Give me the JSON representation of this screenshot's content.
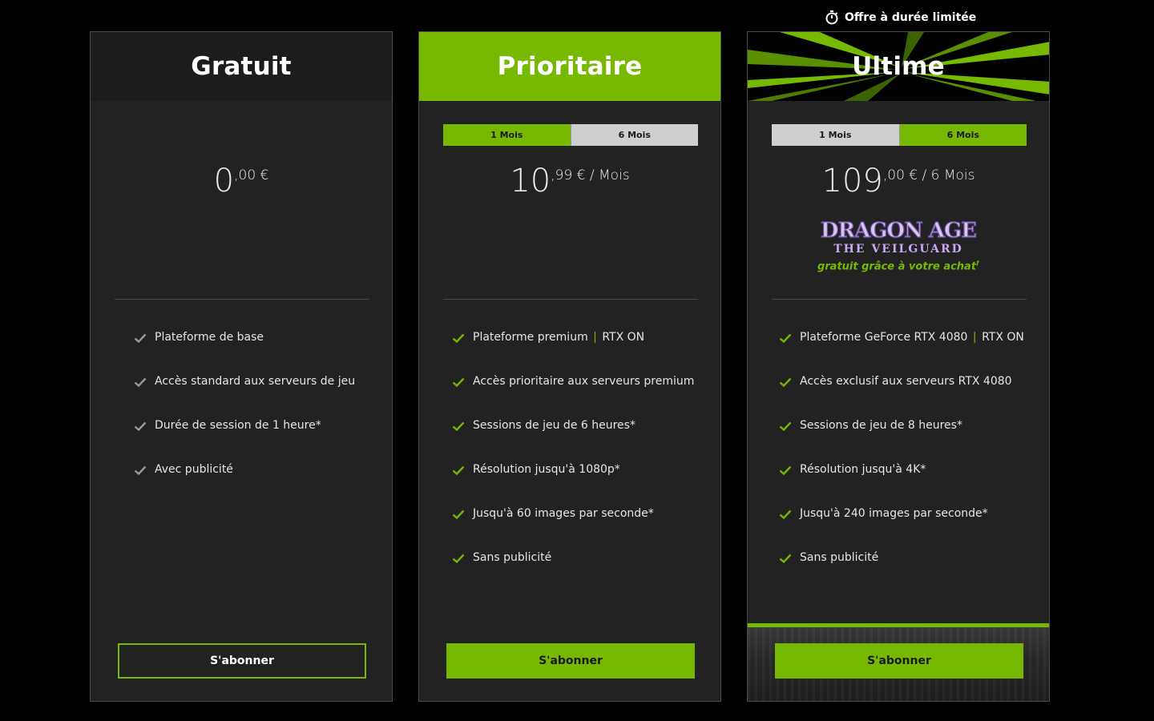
{
  "limited_offer": {
    "label": "Offre à durée limitée",
    "icon": "stopwatch-icon"
  },
  "accent_color": "#76b900",
  "plans": [
    {
      "title": "Gratuit",
      "price_int": "0",
      "price_suffix": ",00 €",
      "features": [
        {
          "text": "Plateforme de base"
        },
        {
          "text": "Accès standard aux serveurs de jeu"
        },
        {
          "text": "Durée de session de 1 heure*"
        },
        {
          "text": "Avec publicité"
        }
      ],
      "button": "S'abonner"
    },
    {
      "title": "Prioritaire",
      "toggle": {
        "options": [
          "1 Mois",
          "6 Mois"
        ],
        "selected": "1 Mois"
      },
      "price_int": "10",
      "price_suffix": ",99 € / Mois",
      "features": [
        {
          "text": "Plateforme premium",
          "extra": "RTX ON"
        },
        {
          "text": "Accès prioritaire aux serveurs premium"
        },
        {
          "text": "Sessions de jeu de 6 heures*"
        },
        {
          "text": "Résolution jusqu'à 1080p*"
        },
        {
          "text": "Jusqu'à 60 images par seconde*"
        },
        {
          "text": "Sans publicité"
        }
      ],
      "button": "S'abonner"
    },
    {
      "title": "Ultime",
      "toggle": {
        "options": [
          "1 Mois",
          "6 Mois"
        ],
        "selected": "6 Mois"
      },
      "price_int": "109",
      "price_suffix": ",00 € / 6 Mois",
      "promo": {
        "logo_line1": "DRAGON AGE",
        "logo_line2": "THE VEILGUARD",
        "text": "gratuit grâce à votre achat",
        "dagger": "†"
      },
      "features": [
        {
          "text": "Plateforme GeForce RTX 4080",
          "extra": "RTX ON"
        },
        {
          "text": "Accès exclusif aux serveurs RTX 4080"
        },
        {
          "text": "Sessions de jeu de 8 heures*"
        },
        {
          "text": "Résolution jusqu'à 4K*"
        },
        {
          "text": "Jusqu'à 240 images par seconde*"
        },
        {
          "text": "Sans publicité"
        }
      ],
      "button": "S'abonner"
    }
  ]
}
